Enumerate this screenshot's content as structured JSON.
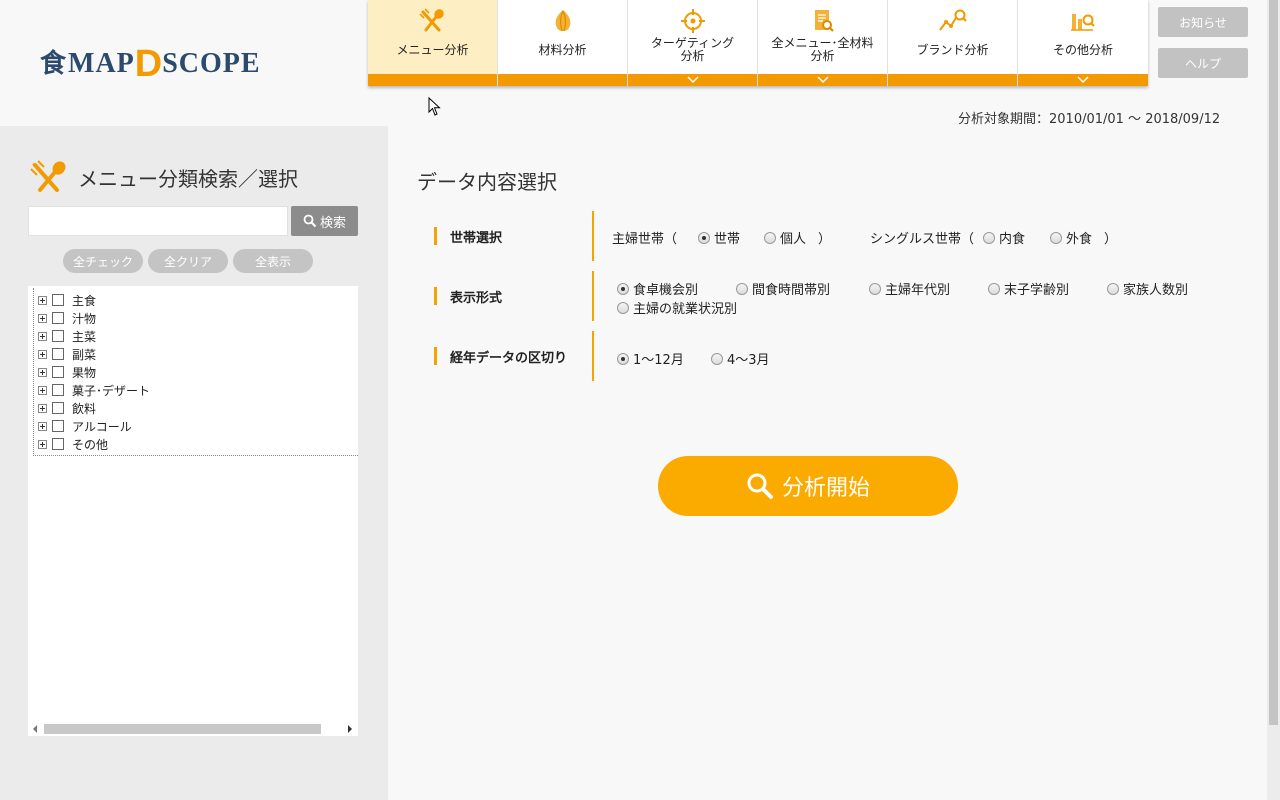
{
  "logo": {
    "kanji": "食",
    "map": "MAP",
    "d": "D",
    "scope": "SCOPE"
  },
  "nav": {
    "tabs": [
      {
        "label": "メニュー分析",
        "icon": "fork-spoon-icon",
        "active": true,
        "has_dropdown": false
      },
      {
        "label": "材料分析",
        "icon": "onion-icon",
        "active": false,
        "has_dropdown": false
      },
      {
        "label": "ターゲティング\n分析",
        "icon": "target-icon",
        "active": false,
        "has_dropdown": true
      },
      {
        "label": "全メニュー･全材料\n分析",
        "icon": "document-search-icon",
        "active": false,
        "has_dropdown": true
      },
      {
        "label": "ブランド分析",
        "icon": "trend-search-icon",
        "active": false,
        "has_dropdown": false
      },
      {
        "label": "その他分析",
        "icon": "bars-search-icon",
        "active": false,
        "has_dropdown": true
      }
    ]
  },
  "side_buttons": {
    "news": "お知らせ",
    "help": "ヘルプ"
  },
  "period": "分析対象期間：2010/01/01 〜 2018/09/12",
  "left": {
    "title": "メニュー分類検索／選択",
    "search_value": "",
    "search_button": "検索",
    "check_all": "全チェック",
    "clear_all": "全クリア",
    "show_all": "全表示",
    "tree": [
      "主食",
      "汁物",
      "主菜",
      "副菜",
      "果物",
      "菓子･デザート",
      "飲料",
      "アルコール",
      "その他"
    ]
  },
  "main": {
    "title": "データ内容選択",
    "household": {
      "label": "世帯選択",
      "housewife_group": "主婦世帯（",
      "opt_household": "世帯",
      "opt_individual": "個人",
      "close1": "）",
      "singles_group": "シングルス世帯（",
      "opt_home": "内食",
      "opt_out": "外食",
      "close2": "）",
      "selected": "世帯"
    },
    "display": {
      "label": "表示形式",
      "options": [
        "食卓機会別",
        "間食時間帯別",
        "主婦年代別",
        "末子学齢別",
        "家族人数別",
        "主婦の就業状況別"
      ],
      "selected": "食卓機会別"
    },
    "period_split": {
      "label": "経年データの区切り",
      "options": [
        "1〜12月",
        "4〜3月"
      ],
      "selected": "1〜12月"
    },
    "start_button": "分析開始"
  },
  "colors": {
    "accent": "#f29a00",
    "button": "#fbaa00",
    "navy": "#2c4a6e"
  }
}
